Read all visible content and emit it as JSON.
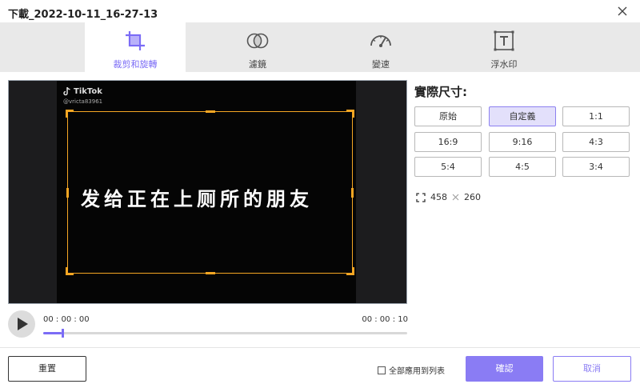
{
  "window": {
    "title": "下載_2022-10-11_16-27-13"
  },
  "tabs": [
    {
      "label": "裁剪和旋轉",
      "icon": "crop-icon",
      "active": true
    },
    {
      "label": "濾鏡",
      "icon": "filter-icon",
      "active": false
    },
    {
      "label": "變速",
      "icon": "speed-icon",
      "active": false
    },
    {
      "label": "浮水印",
      "icon": "watermark-icon",
      "active": false
    }
  ],
  "preview": {
    "brand": "TikTok",
    "username": "@vricta83961",
    "caption": "发给正在上厕所的朋友"
  },
  "player": {
    "current_time": "00 : 00 : 00",
    "total_time": "00 : 00 : 10",
    "progress": 0.05
  },
  "size_panel": {
    "title": "實際尺寸:",
    "ratios": [
      "原始",
      "自定義",
      "1:1",
      "16:9",
      "9:16",
      "4:3",
      "5:4",
      "4:5",
      "3:4"
    ],
    "selected": "自定義",
    "width": "458",
    "height": "260"
  },
  "footer": {
    "reset_label": "重置",
    "apply_all_label": "全部應用到列表",
    "apply_all_checked": false,
    "ok_label": "確認",
    "cancel_label": "取消"
  },
  "colors": {
    "accent": "#8a7cf4",
    "crop_frame": "#f5a623"
  }
}
